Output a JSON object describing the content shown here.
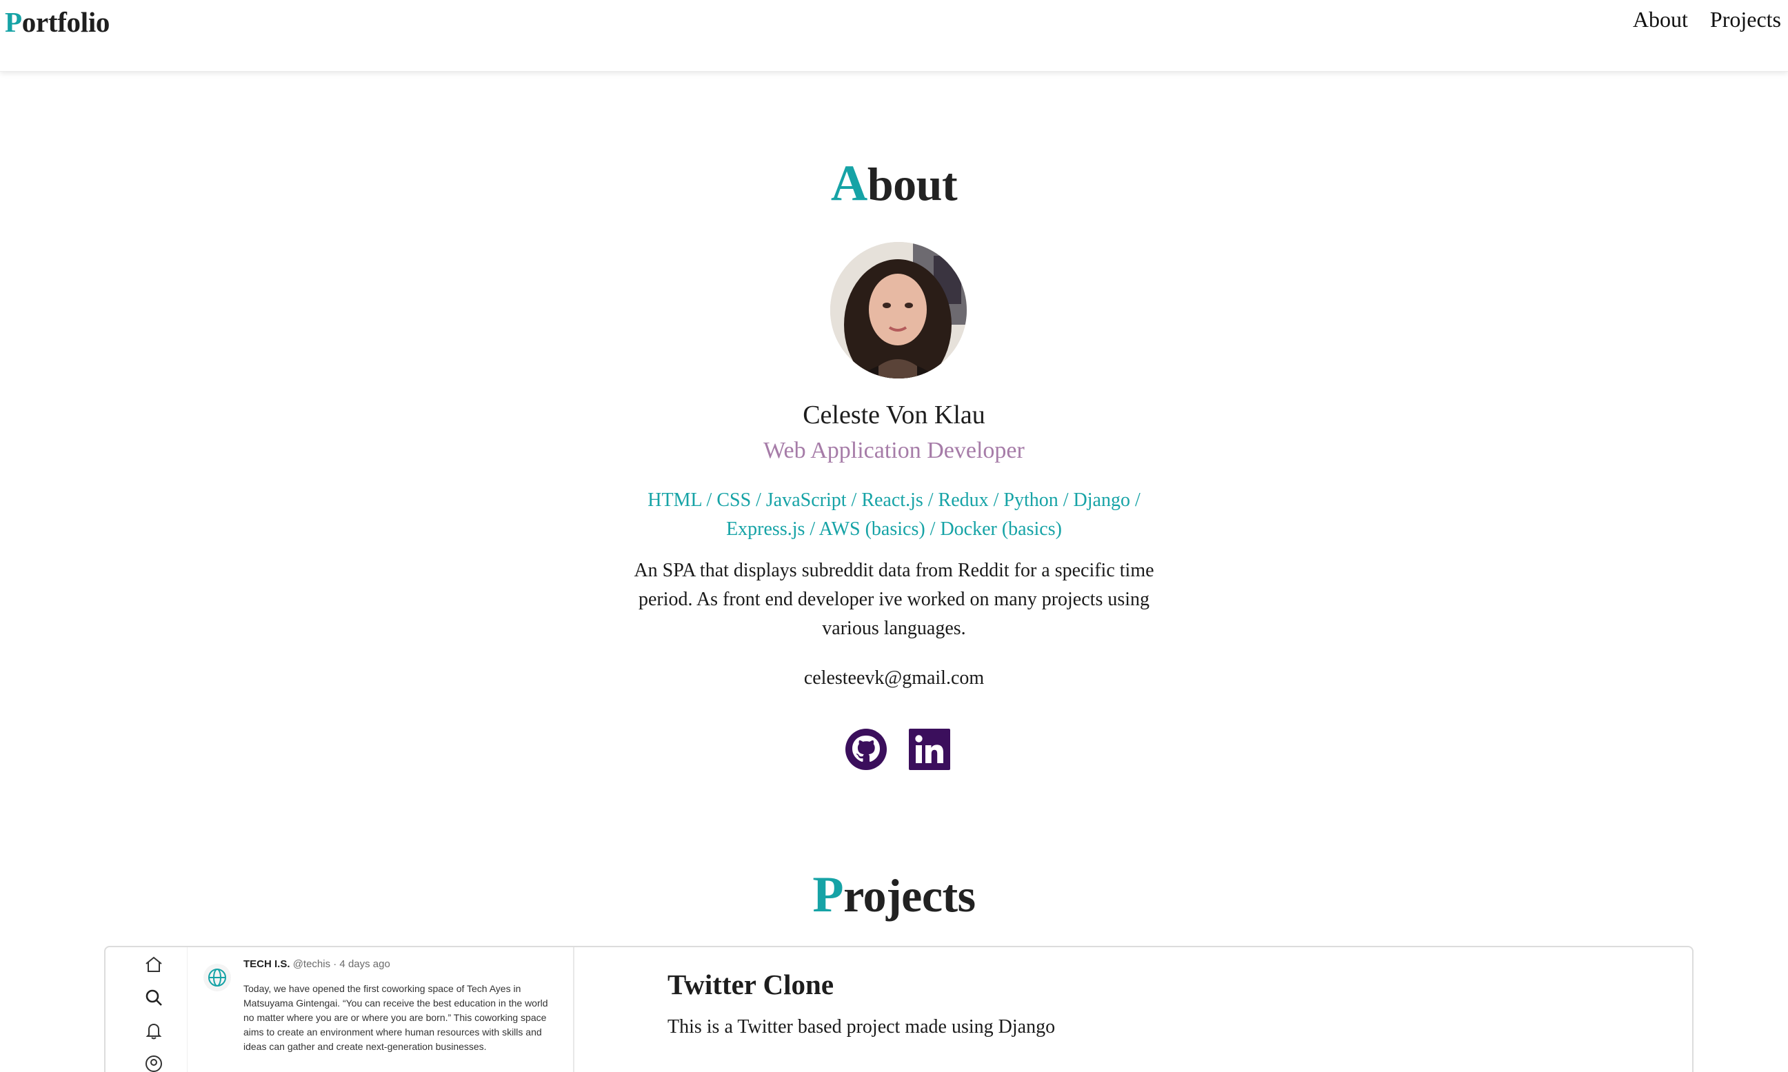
{
  "header": {
    "brand_first": "P",
    "brand_rest": "ortfolio",
    "nav": {
      "about": "About",
      "projects": "Projects"
    }
  },
  "about": {
    "title_first": "A",
    "title_rest": "bout",
    "name": "Celeste Von Klau",
    "role": "Web Application Developer",
    "skills": "HTML / CSS / JavaScript / React.js / Redux / Python / Django / Express.js / AWS (basics) / Docker (basics)",
    "bio": "An SPA that displays subreddit data from Reddit for a specific time period. As front end developer ive worked on many projects using various languages.",
    "email": "celesteevk@gmail.com",
    "socials": [
      "github-icon",
      "linkedin-icon"
    ]
  },
  "projects": {
    "title_first": "P",
    "title_rest": "rojects",
    "items": [
      {
        "title": "Twitter Clone",
        "description": "This is a Twitter based project made using Django",
        "preview": {
          "author": "TECH I.S.",
          "meta": "@techis · 4 days ago",
          "text": "Today, we have opened the first coworking space of Tech Ayes in Matsuyama Gintengai. “You can receive the best education in the world no matter where you are or where you are born.” This coworking space aims to create an environment where human resources with skills and ideas can gather and create next-generation businesses."
        }
      }
    ]
  },
  "colors": {
    "accent": "#16a3a6",
    "role": "#a67ca8",
    "social": "#3b0f5c"
  }
}
